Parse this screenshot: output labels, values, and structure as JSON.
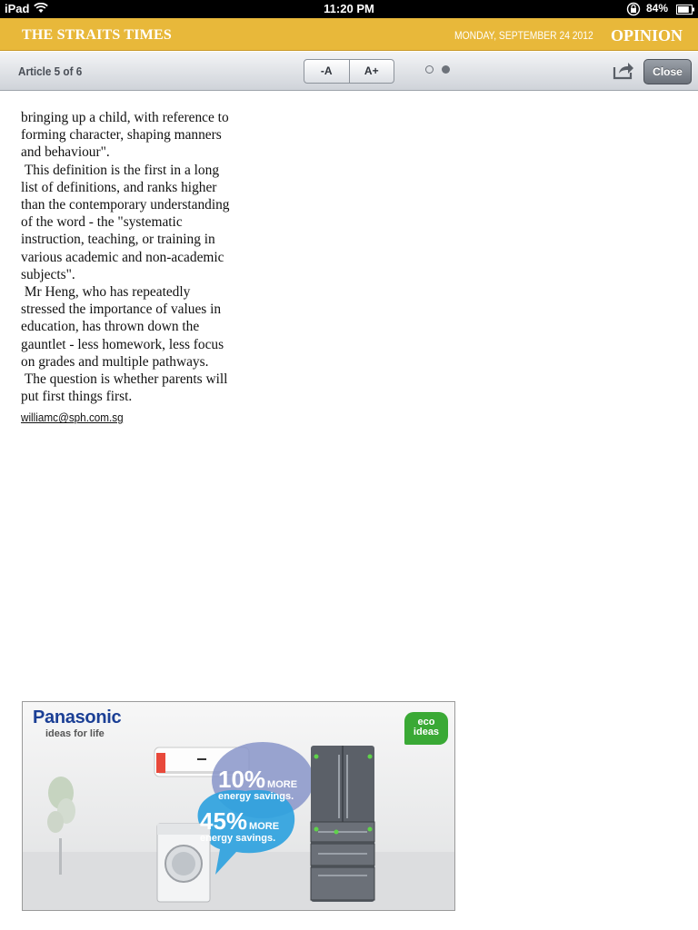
{
  "status_bar": {
    "device": "iPad",
    "time": "11:20 PM",
    "battery": "84%",
    "battery_level": 0.84
  },
  "masthead": {
    "brand": "THE STRAITS TIMES",
    "date": "MONDAY, SEPTEMBER 24 2012",
    "section": "OPINION",
    "color": "#e8b83a"
  },
  "toolbar": {
    "counter": "Article 5 of 6",
    "font_decrease": "-A",
    "font_increase": "A+",
    "page_count": 2,
    "current_page": 2,
    "close_label": "Close",
    "share_icon": "share-icon"
  },
  "article": {
    "paragraphs": [
      "bringing up a child, with reference to forming character, shaping manners and behaviour\".",
      "This definition is the first in a long list of definitions, and ranks higher than the contemporary understanding of the word - the \"systematic instruction, teaching, or training in various academic and non-academic subjects\".",
      "Mr Heng, who has repeatedly stressed the importance of values in education, has thrown down the gauntlet - less homework, less focus on grades and multiple pathways.",
      "The question is whether parents will put first things first."
    ],
    "email": "williamc@sph.com.sg"
  },
  "ad": {
    "brand": "Panasonic",
    "tagline": "ideas for life",
    "badge_line1": "eco",
    "badge_line2": "ideas",
    "claim1_value": "10%",
    "claim1_more": "MORE",
    "claim1_text": "energy savings.",
    "claim2_value": "45%",
    "claim2_more": "MORE",
    "claim2_text": "energy savings.",
    "brand_color": "#1b3f95",
    "eco_color": "#3aa935"
  }
}
